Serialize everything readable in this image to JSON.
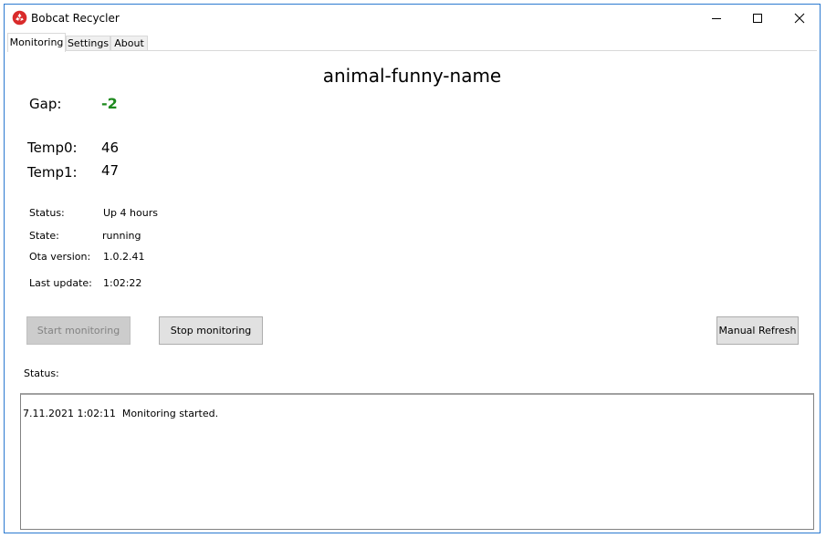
{
  "window": {
    "title": "Bobcat Recycler",
    "icon": "recycle-icon",
    "controls": [
      "minimize-icon",
      "maximize-icon",
      "close-icon"
    ]
  },
  "tabs": [
    {
      "label": "Monitoring",
      "active": true
    },
    {
      "label": "Settings",
      "active": false
    },
    {
      "label": "About",
      "active": false
    }
  ],
  "monitoring": {
    "device_name": "animal-funny-name",
    "gap": {
      "label": "Gap:",
      "value": "-2",
      "color": "#1e8a1e"
    },
    "temp0": {
      "label": "Temp0:",
      "value": "46"
    },
    "temp1": {
      "label": "Temp1:",
      "value": "47"
    },
    "status": {
      "label": "Status:",
      "value": "Up 4 hours"
    },
    "state": {
      "label": "State:",
      "value": "running"
    },
    "ota": {
      "label": "Ota version:",
      "value": "1.0.2.41"
    },
    "last_update": {
      "label": "Last update:",
      "value": "1:02:22"
    },
    "buttons": {
      "start": "Start monitoring",
      "stop": "Stop monitoring",
      "refresh": "Manual Refresh"
    },
    "log_label": "Status:",
    "log_lines": [
      "7.11.2021 1:02:11  Monitoring started."
    ]
  }
}
